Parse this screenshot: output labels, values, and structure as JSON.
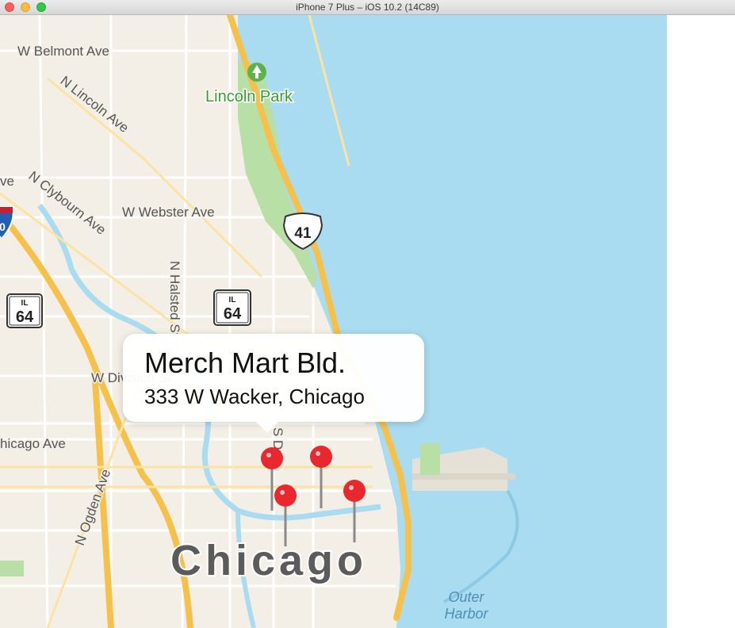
{
  "window": {
    "title": "iPhone 7 Plus – iOS 10.2 (14C89)"
  },
  "map": {
    "streets": {
      "belmont": "W Belmont Ave",
      "lincoln": "N Lincoln Ave",
      "clybourn": "N Clybourn Ave",
      "webster": "W Webster Ave",
      "halsted": "N Halsted St",
      "division": "W Division St",
      "chicago_ave": "hicago Ave",
      "ogden": "N Ogden Ave",
      "ave_fragment": "ve",
      "lasalle_fragment": "S Dr"
    },
    "park": "Lincoln Park",
    "city": "Chicago",
    "harbor_line1": "Outer",
    "harbor_line2": "Harbor",
    "shields": {
      "us41_number": "41",
      "il64_a_state": "IL",
      "il64_a_number": "64",
      "il64_b_state": "IL",
      "il64_b_number": "64",
      "interstate_fragment": "0"
    },
    "colors": {
      "land": "#f4efe6",
      "water": "#a9dcf1",
      "park": "#b8dfa6",
      "highway": "#f5c14b",
      "pin": "#e8272f"
    }
  },
  "callout": {
    "title": "Merch Mart Bld.",
    "subtitle": "333 W Wacker, Chicago"
  }
}
